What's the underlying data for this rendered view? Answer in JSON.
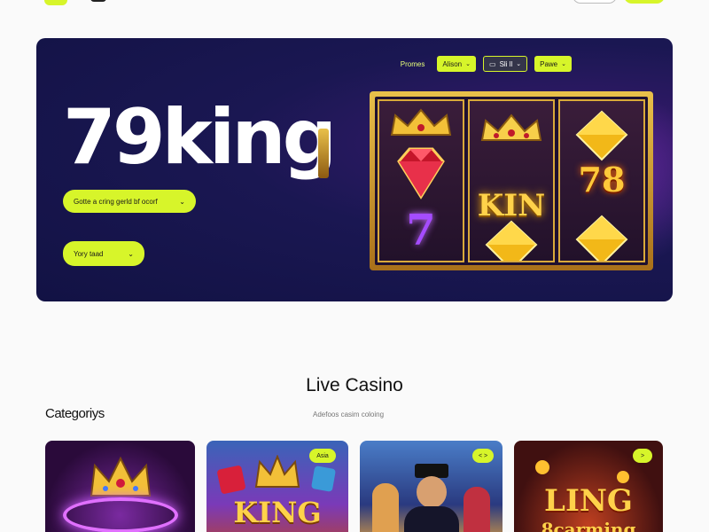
{
  "colors": {
    "accent": "#d7f52a",
    "hero_bg": "#121244"
  },
  "hero": {
    "nav": {
      "label": "Promes",
      "items": [
        {
          "label": "Alison",
          "style": "lime"
        },
        {
          "label": "Sli ll",
          "style": "dark"
        },
        {
          "label": "Pawe",
          "style": "lime"
        }
      ]
    },
    "title": "79king",
    "button_1": "Gotte a cring gerld bf ocorf",
    "button_2": "Yory taad",
    "slot": {
      "reel_1": {
        "top_icon": "crown-icon",
        "mid_icon": "red-gem-icon",
        "bottom_text": "7"
      },
      "reel_2": {
        "top_icon": "crown-icon",
        "mid_text": "KIN",
        "bottom_icon": "gold-gem-icon"
      },
      "reel_3": {
        "top_icon": "gold-gem-icon",
        "mid_text": "78",
        "bottom_icon": "gold-gem-icon"
      }
    }
  },
  "section": {
    "title": "Live Casino",
    "categories_title": "Categoriys",
    "subtitle": "Adefoos casim coloing"
  },
  "cards": [
    {
      "badge": "",
      "art_text": "",
      "icon": "crown-icon"
    },
    {
      "badge": "Asia",
      "art_text": "KING",
      "icon": "crown-icon"
    },
    {
      "badge": "< >",
      "art_text": "",
      "icon": "dealer-icon"
    },
    {
      "badge": ">",
      "art_text": "LING",
      "art_subtext": "8carming",
      "icon": "coin-icon"
    }
  ]
}
